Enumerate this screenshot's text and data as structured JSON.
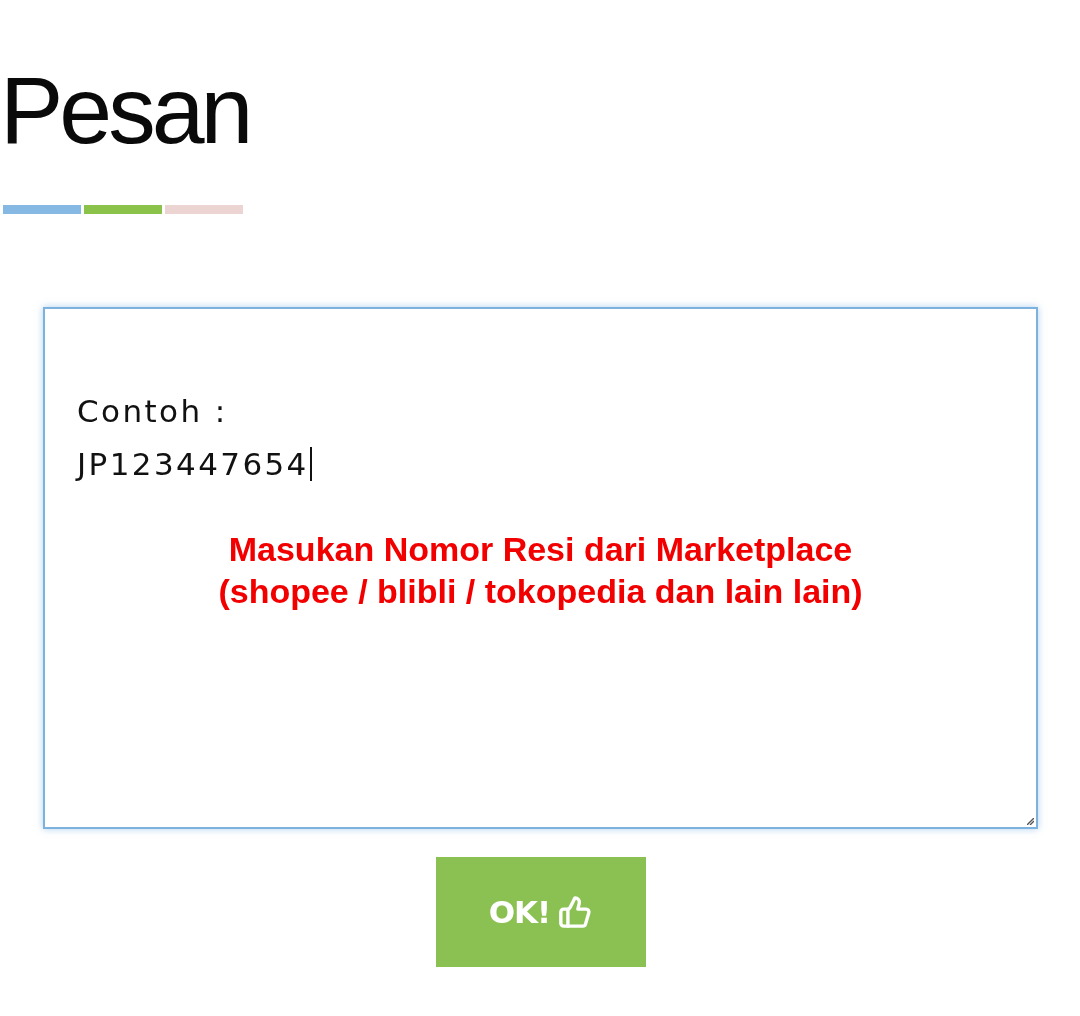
{
  "title": "Pesan",
  "accent_bars": [
    {
      "color": "#85b9e3"
    },
    {
      "color": "#8bc34a"
    },
    {
      "color": "#ecd4d2"
    }
  ],
  "message_field": {
    "value": "Contoh :\nJP123447654",
    "focused": true
  },
  "hint": "Masukan Nomor Resi dari Marketplace\n(shopee / blibli / tokopedia dan lain lain)",
  "button": {
    "label": "OK!"
  }
}
